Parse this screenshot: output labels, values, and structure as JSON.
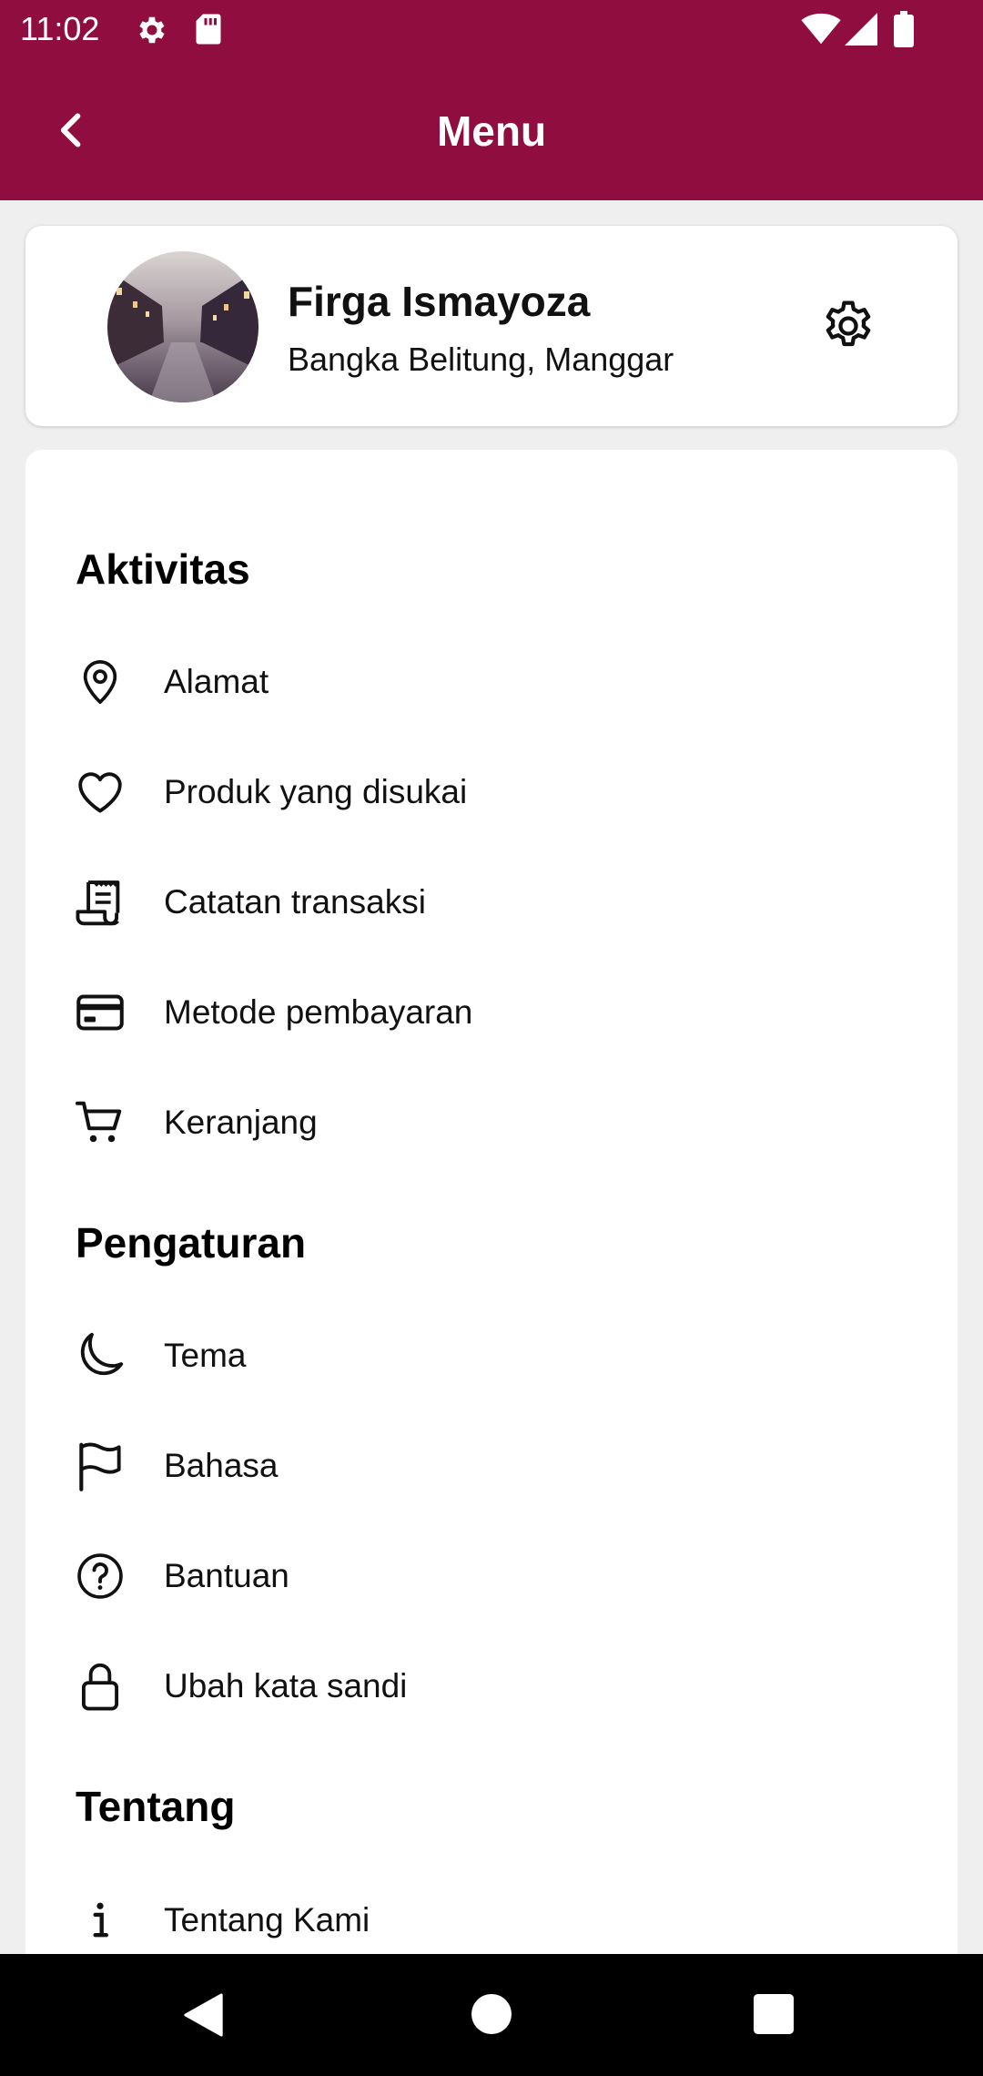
{
  "status_bar": {
    "time": "11:02",
    "icons": [
      "settings-icon",
      "sd-card-icon",
      "wifi-icon",
      "signal-icon",
      "battery-icon"
    ]
  },
  "app_bar": {
    "title": "Menu",
    "back_icon": "chevron-left-icon"
  },
  "profile": {
    "name": "Firga Ismayoza",
    "location": "Bangka Belitung, Manggar",
    "settings_icon": "gear-icon"
  },
  "sections": {
    "aktivitas": {
      "title": "Aktivitas",
      "items": [
        {
          "label": "Alamat",
          "icon": "location-pin-icon"
        },
        {
          "label": "Produk yang disukai",
          "icon": "heart-icon"
        },
        {
          "label": "Catatan transaksi",
          "icon": "receipt-icon"
        },
        {
          "label": "Metode pembayaran",
          "icon": "credit-card-icon"
        },
        {
          "label": "Keranjang",
          "icon": "cart-icon"
        }
      ]
    },
    "pengaturan": {
      "title": "Pengaturan",
      "items": [
        {
          "label": "Tema",
          "icon": "moon-icon"
        },
        {
          "label": "Bahasa",
          "icon": "flag-icon"
        },
        {
          "label": "Bantuan",
          "icon": "help-circle-icon"
        },
        {
          "label": "Ubah kata sandi",
          "icon": "lock-icon"
        }
      ]
    },
    "tentang": {
      "title": "Tentang",
      "items": [
        {
          "label": "Tentang Kami",
          "icon": "info-icon"
        }
      ]
    }
  },
  "colors": {
    "brand": "#8f0d3f",
    "background": "#efefef",
    "card": "#ffffff",
    "text": "#111111",
    "nav_bar": "#000000"
  }
}
